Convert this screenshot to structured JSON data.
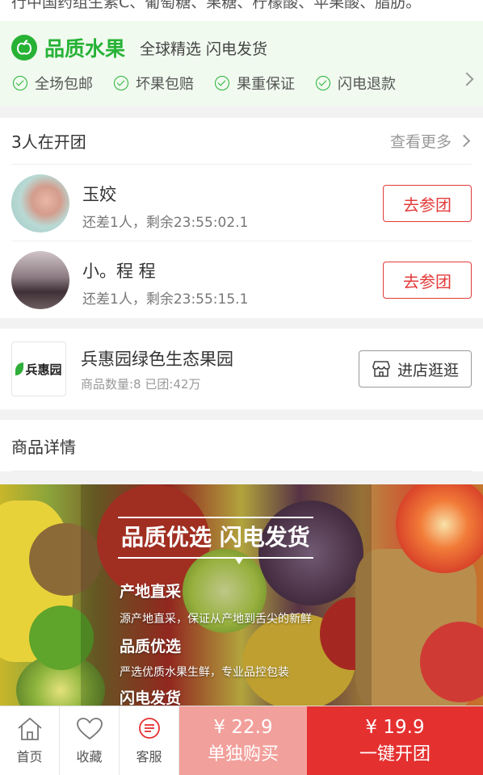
{
  "top_text": "行中国药组生素C、葡萄糖、果糖、柠檬酸、苹果酸、脂肪。",
  "quality": {
    "title": "品质水果",
    "subtitle": "全球精选 闪电发货",
    "features": [
      "全场包邮",
      "坏果包赔",
      "果重保证",
      "闪电退款"
    ]
  },
  "group_buy": {
    "title": "3人在开团",
    "more_label": "查看更多",
    "rows": [
      {
        "name": "玉姣",
        "info": "还差1人，剩余23:55:02.1",
        "button": "去参团"
      },
      {
        "name": "小。程 程",
        "info": "还差1人，剩余23:55:15.1",
        "button": "去参团"
      }
    ]
  },
  "store": {
    "logo_text": "兵惠园",
    "name": "兵惠园绿色生态果园",
    "meta": "商品数量:8 已团:42万",
    "button": "进店逛逛"
  },
  "detail": {
    "title": "商品详情"
  },
  "banner": {
    "headline": "品质优选 闪电发货",
    "sections": [
      {
        "heading": "产地直采",
        "text": "源产地直采，保证从产地到舌尖的新鲜"
      },
      {
        "heading": "品质优选",
        "text": "严选优质水果生鲜，专业品控包装"
      },
      {
        "heading": "闪电发货",
        "text": ""
      }
    ]
  },
  "tabbar": {
    "home": "首页",
    "favorite": "收藏",
    "service": "客服",
    "single_price": "¥ 22.9",
    "single_label": "单独购买",
    "group_price": "¥ 19.9",
    "group_label": "一键开团"
  },
  "colors": {
    "green": "#27b236",
    "red": "#e53030",
    "pink": "#f2a09c"
  }
}
